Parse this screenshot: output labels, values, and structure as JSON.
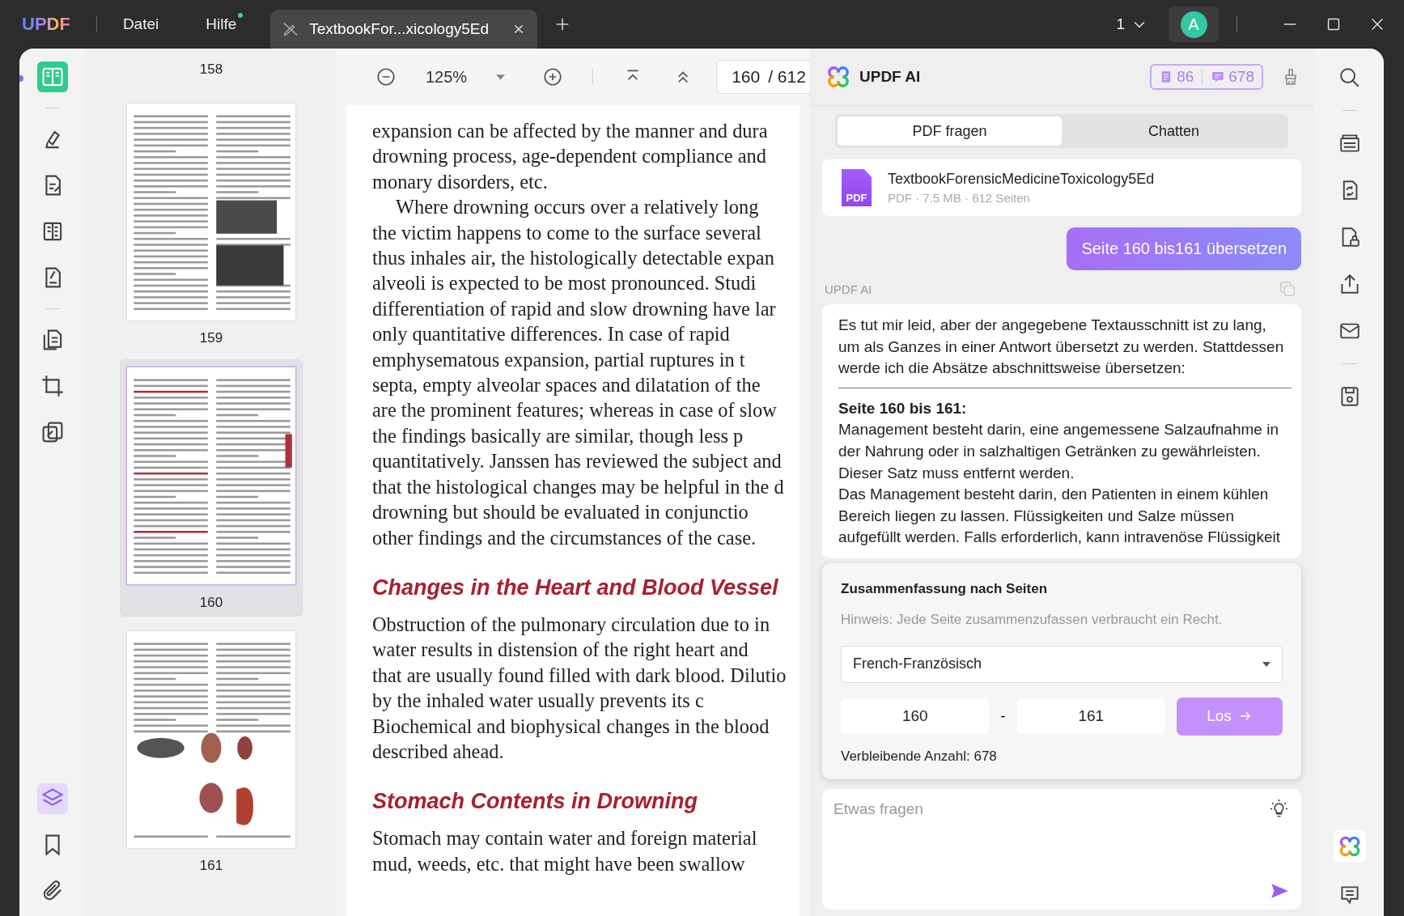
{
  "titlebar": {
    "logo": "UPDF",
    "menus": [
      {
        "label": "Datei",
        "badge": false
      },
      {
        "label": "Hilfe",
        "badge": true
      }
    ],
    "tabs": [
      {
        "title": "TextbookFor...xicology5Ed",
        "selected": true
      }
    ],
    "page_indicator": "1",
    "avatar": "A"
  },
  "tools": [
    {
      "kind": "reader",
      "selected": true
    },
    {
      "kind": "comment",
      "selected": false
    },
    {
      "kind": "edit",
      "selected": false
    },
    {
      "kind": "columns",
      "selected": false
    },
    {
      "kind": "sign",
      "selected": false
    },
    {
      "kind": "organize",
      "selected": false
    },
    {
      "kind": "crop",
      "selected": false
    },
    {
      "kind": "copy",
      "selected": false
    }
  ],
  "panel_tools": [
    {
      "kind": "layers",
      "selected": true
    },
    {
      "kind": "bookmark",
      "selected": false
    },
    {
      "kind": "attachment",
      "selected": false
    }
  ],
  "thumbnails": [
    {
      "label": "158",
      "kind": "hidden",
      "selected": false
    },
    {
      "label": "159",
      "kind": "photos",
      "selected": false
    },
    {
      "label": "160",
      "kind": "text",
      "selected": true
    },
    {
      "label": "161",
      "kind": "diagram",
      "selected": false
    }
  ],
  "doc_toolbar": {
    "zoom": "125%",
    "page": "160",
    "total": "/ 612"
  },
  "document": [
    {
      "kind": "paragraph",
      "indent": false,
      "lines": [
        "expansion can be affected by the manner and dura",
        "drowning process, age-dependent compliance and",
        "monary disorders, etc."
      ]
    },
    {
      "kind": "paragraph",
      "indent": true,
      "lines": [
        "Where drowning occurs over a relatively long",
        "the victim happens to come to the surface several",
        "thus inhales air, the histologically detectable expan",
        "alveoli is expected to be most pronounced. Studi",
        "differentiation of rapid and slow drowning have lar",
        "only quantitative differences. In case of rapid",
        "emphysematous expansion, partial ruptures in t",
        "septa, empty alveolar spaces and dilatation of the",
        "are the prominent features; whereas in case of slow",
        "the findings basically are similar, though less p",
        "quantitatively. Janssen has reviewed the subject and",
        "that the histological changes may be helpful in the d",
        "drowning but should be evaluated in conjunctio",
        "other findings and the circumstances of the case."
      ]
    },
    {
      "kind": "heading",
      "text": "Changes in the Heart and Blood Vessel"
    },
    {
      "kind": "paragraph",
      "indent": false,
      "lines": [
        "Obstruction of the pulmonary circulation due to in",
        "water results in distension of the right heart and",
        "that are usually found filled with dark blood. Dilutio",
        "by the inhaled water usually prevents its c",
        "Biochemical and biophysical changes in the blood",
        "described ahead."
      ]
    },
    {
      "kind": "heading",
      "text": "Stomach Contents in Drowning"
    },
    {
      "kind": "paragraph",
      "indent": false,
      "lines": [
        "Stomach may contain water and foreign material",
        "mud, weeds, etc. that might have been swallow"
      ]
    }
  ],
  "ai": {
    "title": "UPDF AI",
    "page_quota": "86",
    "chat_quota": "678",
    "tabs": [
      {
        "label": "PDF fragen",
        "selected": true
      },
      {
        "label": "Chatten",
        "selected": false
      }
    ],
    "file": {
      "type": "PDF",
      "name": "TextbookForensicMedicineToxicology5Ed",
      "meta": "PDF · 7.5 MB · 612 Seiten"
    },
    "messages": [
      {
        "kind": "user",
        "text": "Seite 160 bis161 übersetzen"
      },
      {
        "kind": "assistant",
        "sender": "UPDF AI",
        "intro": "Es tut mir leid, aber der angegebene Textausschnitt ist zu lang, um als Ganzes in einer Antwort übersetzt zu werden. Stattdessen werde ich die Absätze abschnittsweise übersetzen:",
        "heading": "Seite 160 bis 161:",
        "body": [
          "Management besteht darin, eine angemessene Salzaufnahme in der Nahrung oder in salzhaltigen Getränken zu gewährleisten.",
          "Dieser Satz muss entfernt werden.",
          "Das Management besteht darin, den Patienten in einem kühlen Bereich liegen zu lassen. Flüssigkeiten und Salze müssen aufgefüllt werden. Falls erforderlich, kann intravenöse Flüssigkeit"
        ]
      }
    ],
    "summary": {
      "title": "Zusammenfassung nach Seiten",
      "hint": "Hinweis: Jede Seite zusammenzufassen verbraucht ein Recht.",
      "language": "French-Französisch",
      "from": "160",
      "separator": "-",
      "to": "161",
      "button": "Los",
      "remaining": "Verbleibende Anzahl: 678"
    },
    "input": {
      "placeholder": "Etwas fragen"
    }
  },
  "right_tools": [
    {
      "kind": "search",
      "selected": false
    },
    {
      "kind": "scan",
      "selected": false
    },
    {
      "kind": "convert",
      "selected": false
    },
    {
      "kind": "protect",
      "selected": false
    },
    {
      "kind": "share",
      "selected": false
    },
    {
      "kind": "mail",
      "selected": false
    },
    {
      "kind": "save",
      "selected": false
    },
    {
      "kind": "ai",
      "selected": true
    },
    {
      "kind": "feedback",
      "selected": false
    }
  ]
}
